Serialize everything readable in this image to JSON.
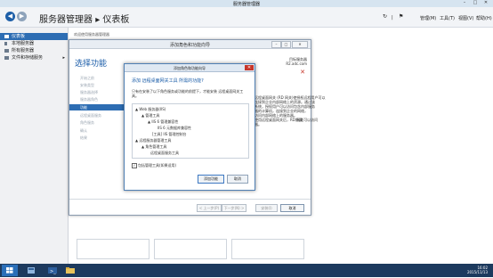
{
  "window": {
    "title": "服务器管理器"
  },
  "header": {
    "breadcrumb_app": "服务器管理器",
    "breadcrumb_sep": "▸",
    "breadcrumb_page": "仪表板",
    "menus": [
      "管理(M)",
      "工具(T)",
      "视图(V)",
      "帮助(H)"
    ]
  },
  "sidebar": {
    "items": [
      {
        "label": "仪表板",
        "icon": "dashboard-icon"
      },
      {
        "label": "本地服务器",
        "icon": "server-icon"
      },
      {
        "label": "所有服务器",
        "icon": "servers-icon"
      },
      {
        "label": "文件和存储服务",
        "icon": "storage-icon"
      }
    ]
  },
  "content": {
    "welcome": "欢迎使用服务器管理器"
  },
  "wizard": {
    "window_title": "添加角色和功能向导",
    "title": "选择功能",
    "target_label": "目标服务器",
    "target_value": "R2.adc.com",
    "steps": [
      "开始之前",
      "安装类型",
      "服务器选择",
      "服务器角色",
      "功能",
      "远程桌面服务",
      "角色服务",
      "确认",
      "结果"
    ],
    "right_text": [
      "远程桌面网关 (RD 网关)使授权远程用户可以",
      "连接到企业内部网络上的资源。通过该",
      "系统，授权用户可以访问包含内部服务",
      "器的计算机，连接到企业的网络，",
      "访问内部网络上的服务器。",
      "使用远程桌面网关后，RD 网关可以访问",
      "器。"
    ],
    "right_tail": "隐藏",
    "buttons": {
      "prev": "< 上一步(P)",
      "next": "下一步(N) >",
      "install": "安装(I)",
      "cancel": "取消"
    }
  },
  "modal": {
    "title": "添加角色和功能向导",
    "question": "添加 远程桌面网关工具 所需的功能?",
    "description": "只有在安装了以下角色服务或功能的前提下，才能安装 远程桌面网关工具。",
    "tree": [
      {
        "label": "Web 服务器(IIS)",
        "level": 0,
        "expander": "▲"
      },
      {
        "label": "管理工具",
        "level": 1,
        "expander": "▲"
      },
      {
        "label": "IIS 6 管理兼容性",
        "level": 2,
        "expander": "▲"
      },
      {
        "label": "IIS 6 元数据库兼容性",
        "level": 3,
        "expander": ""
      },
      {
        "label": "[工具] IIS 管理控制台",
        "level": 2,
        "expander": ""
      },
      {
        "label": "远程服务器管理工具",
        "level": 0,
        "expander": "▲"
      },
      {
        "label": "角色管理工具",
        "level": 1,
        "expander": "▲"
      },
      {
        "label": "远程桌面服务工具",
        "level": 2,
        "expander": ""
      }
    ],
    "checkbox_mark": "✓",
    "checkbox_label": "包括管理工具(如果适用)",
    "add_button": "添加功能",
    "cancel_button": "取消"
  },
  "taskbar": {
    "time": "16:02",
    "date": "2015/11/13"
  }
}
